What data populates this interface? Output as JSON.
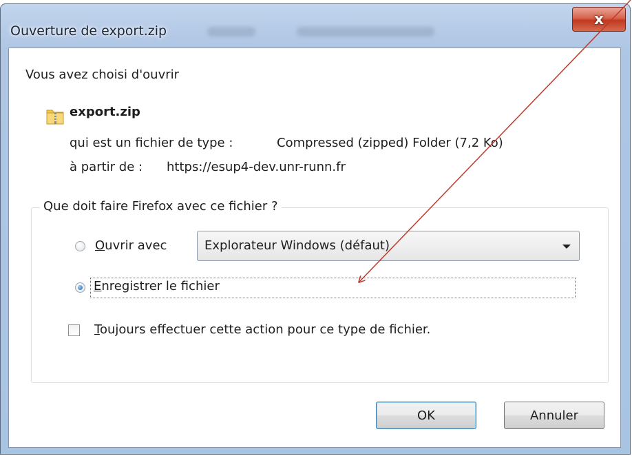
{
  "window": {
    "title": "Ouverture de export.zip",
    "close_label": "x"
  },
  "content": {
    "intro": "Vous avez choisi d'ouvrir",
    "file_name": "export.zip",
    "file_icon": "zip-folder-icon",
    "type_label": "qui est un fichier de type :",
    "type_value": "Compressed (zipped) Folder (7,2 Ko)",
    "from_label": "à partir de :",
    "from_value": "https://esup4-dev.unr-runn.fr"
  },
  "action_group": {
    "legend": "Que doit faire Firefox avec ce fichier ?",
    "open_with": {
      "accesskey": "O",
      "label_rest": "uvrir avec",
      "checked": false,
      "app_selected": "Explorateur Windows (défaut)"
    },
    "save_file": {
      "accesskey": "E",
      "label_rest": "nregistrer le fichier",
      "checked": true
    },
    "always": {
      "accesskey": "T",
      "label_rest": "oujours effectuer cette action pour ce type de fichier.",
      "checked": false
    }
  },
  "buttons": {
    "ok": "OK",
    "cancel": "Annuler"
  },
  "colors": {
    "annotation_arrow": "#c0392b",
    "title_gradient_top": "#c2d5ee",
    "close_button": "#c2391f"
  }
}
